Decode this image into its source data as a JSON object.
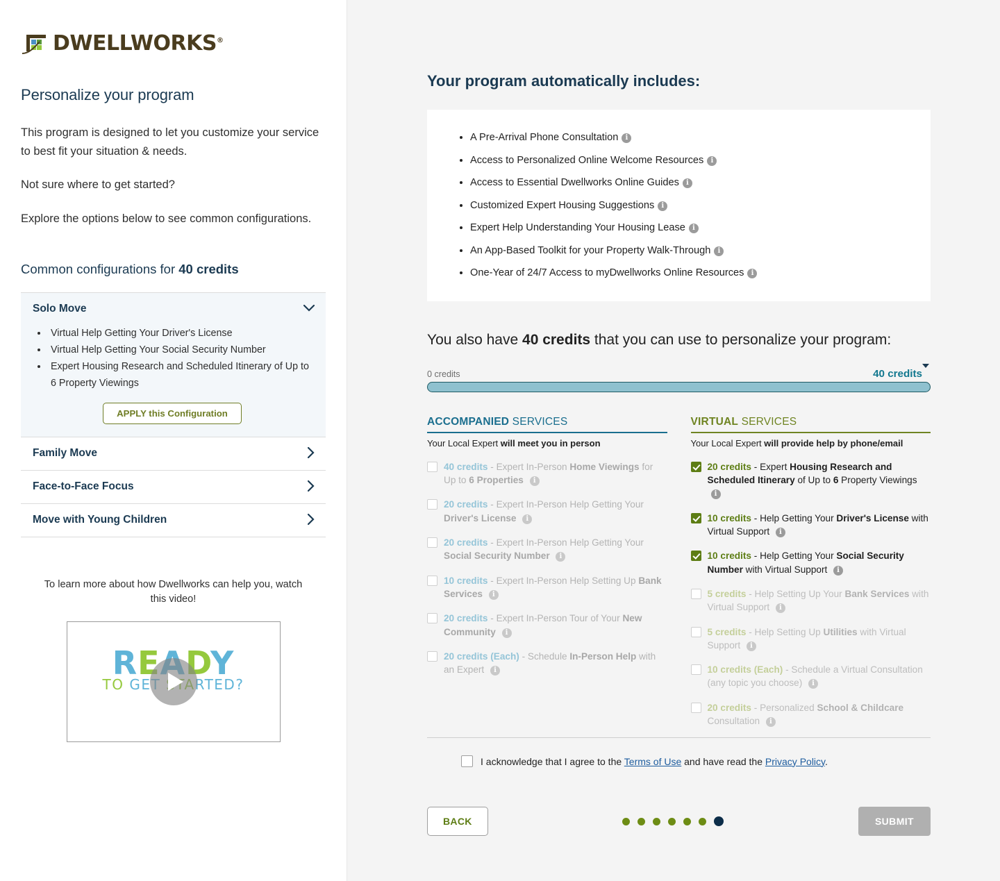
{
  "brand": {
    "name": "DWELLWORKS",
    "registered": "®",
    "logo_colors": {
      "brown": "#4a3c1e",
      "blue": "#4a90c4",
      "green_light": "#95c93d",
      "green_dark": "#5a9a3c"
    }
  },
  "left": {
    "heading": "Personalize your program",
    "paragraphs": [
      "This program is designed to let you customize your service to best fit your situation & needs.",
      "Not sure where to get started?",
      "Explore the options below to see common configurations."
    ],
    "configs_heading_prefix": "Common configurations for ",
    "configs_heading_credits": "40 credits",
    "accordion": [
      {
        "title": "Solo Move",
        "open": true,
        "chevron": "chevron-down",
        "bullets": [
          "Virtual Help Getting Your Driver's License",
          "Virtual Help Getting Your Social Security Number",
          "Expert Housing Research and Scheduled Itinerary of Up to 6 Property Viewings"
        ],
        "apply_label": "APPLY this Configuration"
      },
      {
        "title": "Family Move",
        "open": false,
        "chevron": "chevron-right"
      },
      {
        "title": "Face-to-Face Focus",
        "open": false,
        "chevron": "chevron-right"
      },
      {
        "title": "Move with Young Children",
        "open": false,
        "chevron": "chevron-right"
      }
    ],
    "video": {
      "caption": "To learn more about how Dwellworks can help you, watch this video!",
      "title_line1": "READY",
      "title_line2": "TO GET STARTED?",
      "play_icon": "play-icon"
    }
  },
  "right": {
    "includes_heading": "Your program automatically includes:",
    "includes": [
      "A Pre-Arrival Phone Consultation",
      "Access to Personalized Online Welcome Resources",
      "Access to Essential Dwellworks Online Guides",
      "Customized Expert Housing Suggestions",
      "Expert Help Understanding Your Housing Lease",
      "An App-Based Toolkit for your Property Walk-Through",
      "One-Year of 24/7 Access to myDwellworks Online Resources"
    ],
    "credits_line": {
      "prefix": "You also have ",
      "amount": "40 credits",
      "suffix": " that you can use to personalize your program:"
    },
    "slider": {
      "min_label": "0 credits",
      "max_label": "40 credits",
      "value": 40,
      "min": 0,
      "max": 40,
      "fill_color": "#8fc1cf",
      "border_color": "#1e5a63"
    },
    "columns": [
      {
        "key": "accompanied",
        "head_bold": "ACCOMPANIED",
        "head_rest": " SERVICES",
        "accent": "#1a6e8e",
        "sub_normal": "Your Local Expert ",
        "sub_bold": "will meet you in person",
        "services": [
          {
            "credits": "40 credits",
            "checked": false,
            "parts": [
              {
                "t": " - Expert In-Person ",
                "b": false
              },
              {
                "t": "Home Viewings",
                "b": true
              },
              {
                "t": " for Up to ",
                "b": false
              },
              {
                "t": "6",
                "b": true
              },
              {
                "t": " Properties",
                "b": true
              }
            ]
          },
          {
            "credits": "20 credits",
            "checked": false,
            "parts": [
              {
                "t": " - Expert In-Person Help Getting Your ",
                "b": false
              },
              {
                "t": "Driver's License",
                "b": true
              }
            ]
          },
          {
            "credits": "20 credits",
            "checked": false,
            "parts": [
              {
                "t": " - Expert In-Person Help Getting Your ",
                "b": false
              },
              {
                "t": "Social Security Number",
                "b": true
              }
            ]
          },
          {
            "credits": "10 credits",
            "checked": false,
            "parts": [
              {
                "t": " - Expert In-Person Help Setting Up ",
                "b": false
              },
              {
                "t": "Bank Services",
                "b": true
              }
            ]
          },
          {
            "credits": "20 credits",
            "checked": false,
            "parts": [
              {
                "t": " - Expert In-Person Tour of Your ",
                "b": false
              },
              {
                "t": "New Community",
                "b": true
              }
            ]
          },
          {
            "credits": "20 credits (Each)",
            "checked": false,
            "parts": [
              {
                "t": " - Schedule ",
                "b": false
              },
              {
                "t": "In-Person Help",
                "b": true
              },
              {
                "t": " with an Expert",
                "b": false
              }
            ]
          }
        ]
      },
      {
        "key": "virtual",
        "head_bold": "VIRTUAL",
        "head_rest": " SERVICES",
        "accent": "#6f8422",
        "sub_normal": "Your Local Expert ",
        "sub_bold": "will provide help by phone/email",
        "services": [
          {
            "credits": "20 credits",
            "checked": true,
            "parts": [
              {
                "t": " - Expert ",
                "b": false
              },
              {
                "t": "Housing Research and Scheduled Itinerary",
                "b": true
              },
              {
                "t": " of Up to ",
                "b": false
              },
              {
                "t": "6",
                "b": true
              },
              {
                "t": " Property Viewings",
                "b": false
              }
            ]
          },
          {
            "credits": "10 credits",
            "checked": true,
            "parts": [
              {
                "t": " - Help Getting Your ",
                "b": false
              },
              {
                "t": "Driver's License",
                "b": true
              },
              {
                "t": " with Virtual Support",
                "b": false
              }
            ]
          },
          {
            "credits": "10 credits",
            "checked": true,
            "parts": [
              {
                "t": " - Help Getting Your ",
                "b": false
              },
              {
                "t": "Social Security Number",
                "b": true
              },
              {
                "t": " with Virtual Support",
                "b": false
              }
            ]
          },
          {
            "credits": "5 credits",
            "checked": false,
            "parts": [
              {
                "t": " - Help Setting Up Your ",
                "b": false
              },
              {
                "t": "Bank Services",
                "b": true
              },
              {
                "t": " with Virtual Support",
                "b": false
              }
            ]
          },
          {
            "credits": "5 credits",
            "checked": false,
            "parts": [
              {
                "t": " - Help Setting Up ",
                "b": false
              },
              {
                "t": "Utilities",
                "b": true
              },
              {
                "t": " with Virtual Support",
                "b": false
              }
            ]
          },
          {
            "credits": "10 credits (Each)",
            "checked": false,
            "parts": [
              {
                "t": " - Schedule a Virtual Consultation (any topic you choose)",
                "b": false
              }
            ]
          },
          {
            "credits": "20 credits",
            "checked": false,
            "parts": [
              {
                "t": " - Personalized ",
                "b": false
              },
              {
                "t": "School & Childcare",
                "b": true
              },
              {
                "t": " Consultation",
                "b": false
              }
            ]
          }
        ]
      }
    ],
    "footer": {
      "terms_checked": false,
      "terms_pre": "I acknowledge that I agree to the ",
      "terms_link": "Terms of Use",
      "terms_mid": " and have read the ",
      "privacy_link": "Privacy Policy",
      "terms_end": ".",
      "back_label": "BACK",
      "submit_label": "SUBMIT",
      "dots_total": 7,
      "dots_active_index": 6
    }
  }
}
